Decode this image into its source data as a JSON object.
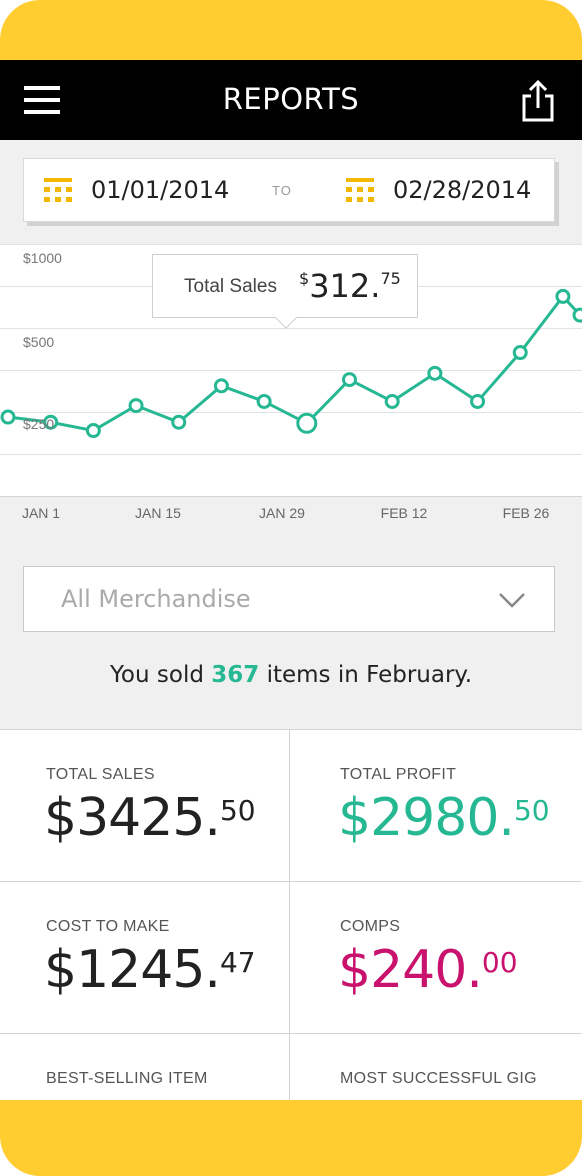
{
  "header": {
    "title": "REPORTS"
  },
  "date_range": {
    "from": "01/01/2014",
    "to_label": "TO",
    "to": "02/28/2014"
  },
  "chart_data": {
    "type": "line",
    "y_ticks": [
      "$1000",
      "$500",
      "$250"
    ],
    "x_ticks": [
      "JAN 1",
      "JAN 15",
      "JAN 29",
      "FEB 12",
      "FEB 26"
    ],
    "series": [
      {
        "values": [
          [
            -4,
            370
          ],
          [
            1,
            345
          ],
          [
            6,
            305
          ],
          [
            11,
            425
          ],
          [
            16,
            345
          ],
          [
            21,
            520
          ],
          [
            26,
            445
          ],
          [
            31,
            340
          ],
          [
            36,
            550
          ],
          [
            41,
            445
          ],
          [
            46,
            580
          ],
          [
            51,
            445
          ],
          [
            56,
            680
          ],
          [
            61,
            950
          ],
          [
            63,
            860
          ]
        ]
      }
    ],
    "highlight": {
      "x": 31,
      "y": 340
    },
    "ylim": [
      0,
      1000
    ],
    "xlim": [
      -4,
      63
    ],
    "grid": true,
    "line_color": "#25b892"
  },
  "tooltip": {
    "label": "Total Sales",
    "currency": "$",
    "whole": "312.",
    "cents": "75"
  },
  "filter": {
    "selected": "All Merchandise"
  },
  "sold": {
    "prefix": "You sold ",
    "count": "367",
    "suffix": " items in February."
  },
  "stats": {
    "total_sales": {
      "label": "TOTAL SALES",
      "whole": "$3425.",
      "cents": "50"
    },
    "total_profit": {
      "label": "TOTAL PROFIT",
      "whole": "$2980.",
      "cents": "50"
    },
    "cost_to_make": {
      "label": "COST TO MAKE",
      "whole": "$1245.",
      "cents": "47"
    },
    "comps": {
      "label": "COMPS",
      "whole": "$240.",
      "cents": "00"
    },
    "best_selling_item": {
      "label": "BEST-SELLING ITEM"
    },
    "most_successful_gig": {
      "label": "MOST SUCCESSFUL GIG"
    }
  },
  "colors": {
    "accent_green": "#25b892",
    "accent_magenta": "#c9126d",
    "brand_yellow": "#ffcd2f",
    "calendar_icon": "#f5b800"
  }
}
